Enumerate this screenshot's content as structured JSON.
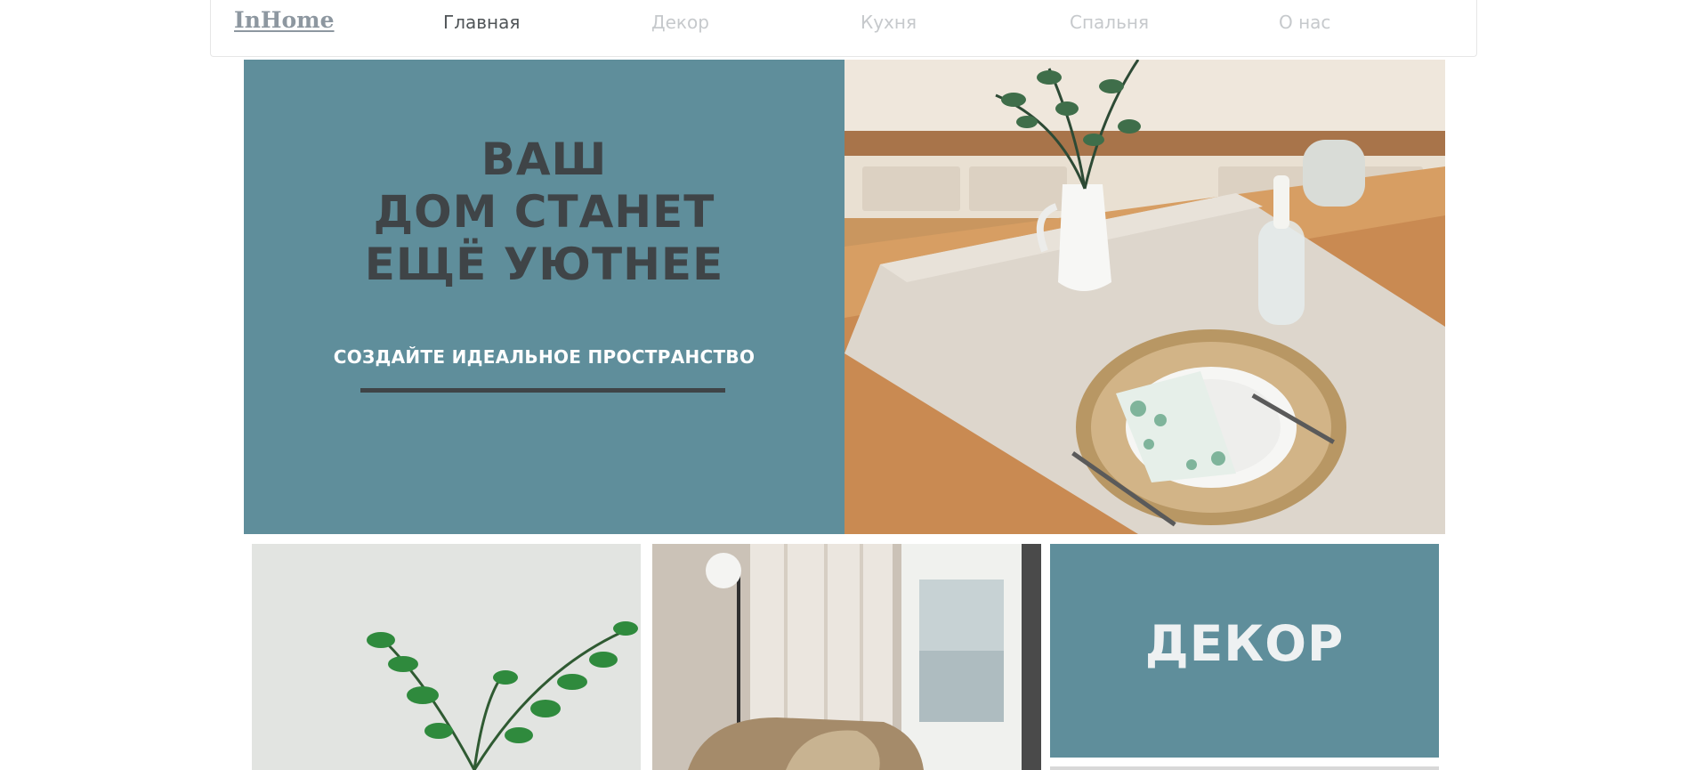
{
  "nav": {
    "logo": "InHome",
    "links": [
      {
        "label": "Главная",
        "active": true
      },
      {
        "label": "Декор",
        "active": false
      },
      {
        "label": "Кухня",
        "active": false
      },
      {
        "label": "Спальня",
        "active": false
      },
      {
        "label": "О нас",
        "active": false
      }
    ]
  },
  "hero": {
    "title_lines": [
      "ВАШ",
      "ДОМ СТАНЕТ",
      "ЕЩЁ УЮТНЕЕ"
    ],
    "cta": "СОЗДАЙТЕ ИДЕАЛЬНОЕ ПРОСТРАНСТВО",
    "image": "kitchen-table-photo"
  },
  "tiles": [
    {
      "image": "green-plant-photo"
    },
    {
      "image": "bedroom-window-photo"
    },
    {
      "title": "ДЕКОР"
    }
  ],
  "colors": {
    "accent": "#5f8e9b",
    "dark_text": "#3f4447",
    "nav_active": "#505558",
    "nav_inactive": "#c6c9cc",
    "logo": "#8d97a0"
  }
}
